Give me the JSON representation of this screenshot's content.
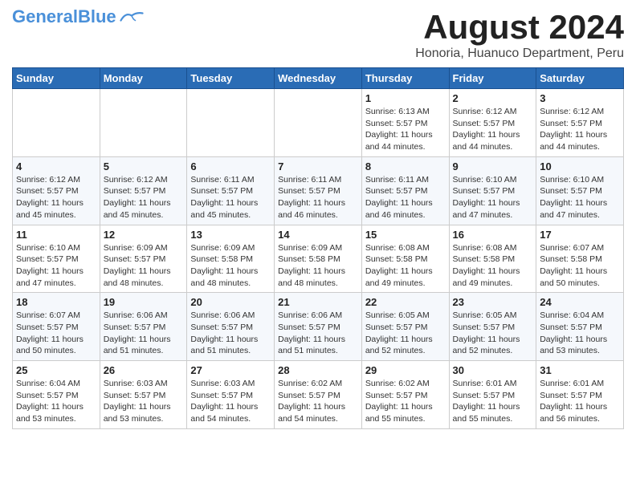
{
  "logo": {
    "general": "General",
    "blue": "Blue"
  },
  "title": "August 2024",
  "subtitle": "Honoria, Huanuco Department, Peru",
  "days_of_week": [
    "Sunday",
    "Monday",
    "Tuesday",
    "Wednesday",
    "Thursday",
    "Friday",
    "Saturday"
  ],
  "weeks": [
    [
      {
        "day": "",
        "info": ""
      },
      {
        "day": "",
        "info": ""
      },
      {
        "day": "",
        "info": ""
      },
      {
        "day": "",
        "info": ""
      },
      {
        "day": "1",
        "info": "Sunrise: 6:13 AM\nSunset: 5:57 PM\nDaylight: 11 hours\nand 44 minutes."
      },
      {
        "day": "2",
        "info": "Sunrise: 6:12 AM\nSunset: 5:57 PM\nDaylight: 11 hours\nand 44 minutes."
      },
      {
        "day": "3",
        "info": "Sunrise: 6:12 AM\nSunset: 5:57 PM\nDaylight: 11 hours\nand 44 minutes."
      }
    ],
    [
      {
        "day": "4",
        "info": "Sunrise: 6:12 AM\nSunset: 5:57 PM\nDaylight: 11 hours\nand 45 minutes."
      },
      {
        "day": "5",
        "info": "Sunrise: 6:12 AM\nSunset: 5:57 PM\nDaylight: 11 hours\nand 45 minutes."
      },
      {
        "day": "6",
        "info": "Sunrise: 6:11 AM\nSunset: 5:57 PM\nDaylight: 11 hours\nand 45 minutes."
      },
      {
        "day": "7",
        "info": "Sunrise: 6:11 AM\nSunset: 5:57 PM\nDaylight: 11 hours\nand 46 minutes."
      },
      {
        "day": "8",
        "info": "Sunrise: 6:11 AM\nSunset: 5:57 PM\nDaylight: 11 hours\nand 46 minutes."
      },
      {
        "day": "9",
        "info": "Sunrise: 6:10 AM\nSunset: 5:57 PM\nDaylight: 11 hours\nand 47 minutes."
      },
      {
        "day": "10",
        "info": "Sunrise: 6:10 AM\nSunset: 5:57 PM\nDaylight: 11 hours\nand 47 minutes."
      }
    ],
    [
      {
        "day": "11",
        "info": "Sunrise: 6:10 AM\nSunset: 5:57 PM\nDaylight: 11 hours\nand 47 minutes."
      },
      {
        "day": "12",
        "info": "Sunrise: 6:09 AM\nSunset: 5:57 PM\nDaylight: 11 hours\nand 48 minutes."
      },
      {
        "day": "13",
        "info": "Sunrise: 6:09 AM\nSunset: 5:58 PM\nDaylight: 11 hours\nand 48 minutes."
      },
      {
        "day": "14",
        "info": "Sunrise: 6:09 AM\nSunset: 5:58 PM\nDaylight: 11 hours\nand 48 minutes."
      },
      {
        "day": "15",
        "info": "Sunrise: 6:08 AM\nSunset: 5:58 PM\nDaylight: 11 hours\nand 49 minutes."
      },
      {
        "day": "16",
        "info": "Sunrise: 6:08 AM\nSunset: 5:58 PM\nDaylight: 11 hours\nand 49 minutes."
      },
      {
        "day": "17",
        "info": "Sunrise: 6:07 AM\nSunset: 5:58 PM\nDaylight: 11 hours\nand 50 minutes."
      }
    ],
    [
      {
        "day": "18",
        "info": "Sunrise: 6:07 AM\nSunset: 5:57 PM\nDaylight: 11 hours\nand 50 minutes."
      },
      {
        "day": "19",
        "info": "Sunrise: 6:06 AM\nSunset: 5:57 PM\nDaylight: 11 hours\nand 51 minutes."
      },
      {
        "day": "20",
        "info": "Sunrise: 6:06 AM\nSunset: 5:57 PM\nDaylight: 11 hours\nand 51 minutes."
      },
      {
        "day": "21",
        "info": "Sunrise: 6:06 AM\nSunset: 5:57 PM\nDaylight: 11 hours\nand 51 minutes."
      },
      {
        "day": "22",
        "info": "Sunrise: 6:05 AM\nSunset: 5:57 PM\nDaylight: 11 hours\nand 52 minutes."
      },
      {
        "day": "23",
        "info": "Sunrise: 6:05 AM\nSunset: 5:57 PM\nDaylight: 11 hours\nand 52 minutes."
      },
      {
        "day": "24",
        "info": "Sunrise: 6:04 AM\nSunset: 5:57 PM\nDaylight: 11 hours\nand 53 minutes."
      }
    ],
    [
      {
        "day": "25",
        "info": "Sunrise: 6:04 AM\nSunset: 5:57 PM\nDaylight: 11 hours\nand 53 minutes."
      },
      {
        "day": "26",
        "info": "Sunrise: 6:03 AM\nSunset: 5:57 PM\nDaylight: 11 hours\nand 53 minutes."
      },
      {
        "day": "27",
        "info": "Sunrise: 6:03 AM\nSunset: 5:57 PM\nDaylight: 11 hours\nand 54 minutes."
      },
      {
        "day": "28",
        "info": "Sunrise: 6:02 AM\nSunset: 5:57 PM\nDaylight: 11 hours\nand 54 minutes."
      },
      {
        "day": "29",
        "info": "Sunrise: 6:02 AM\nSunset: 5:57 PM\nDaylight: 11 hours\nand 55 minutes."
      },
      {
        "day": "30",
        "info": "Sunrise: 6:01 AM\nSunset: 5:57 PM\nDaylight: 11 hours\nand 55 minutes."
      },
      {
        "day": "31",
        "info": "Sunrise: 6:01 AM\nSunset: 5:57 PM\nDaylight: 11 hours\nand 56 minutes."
      }
    ]
  ]
}
